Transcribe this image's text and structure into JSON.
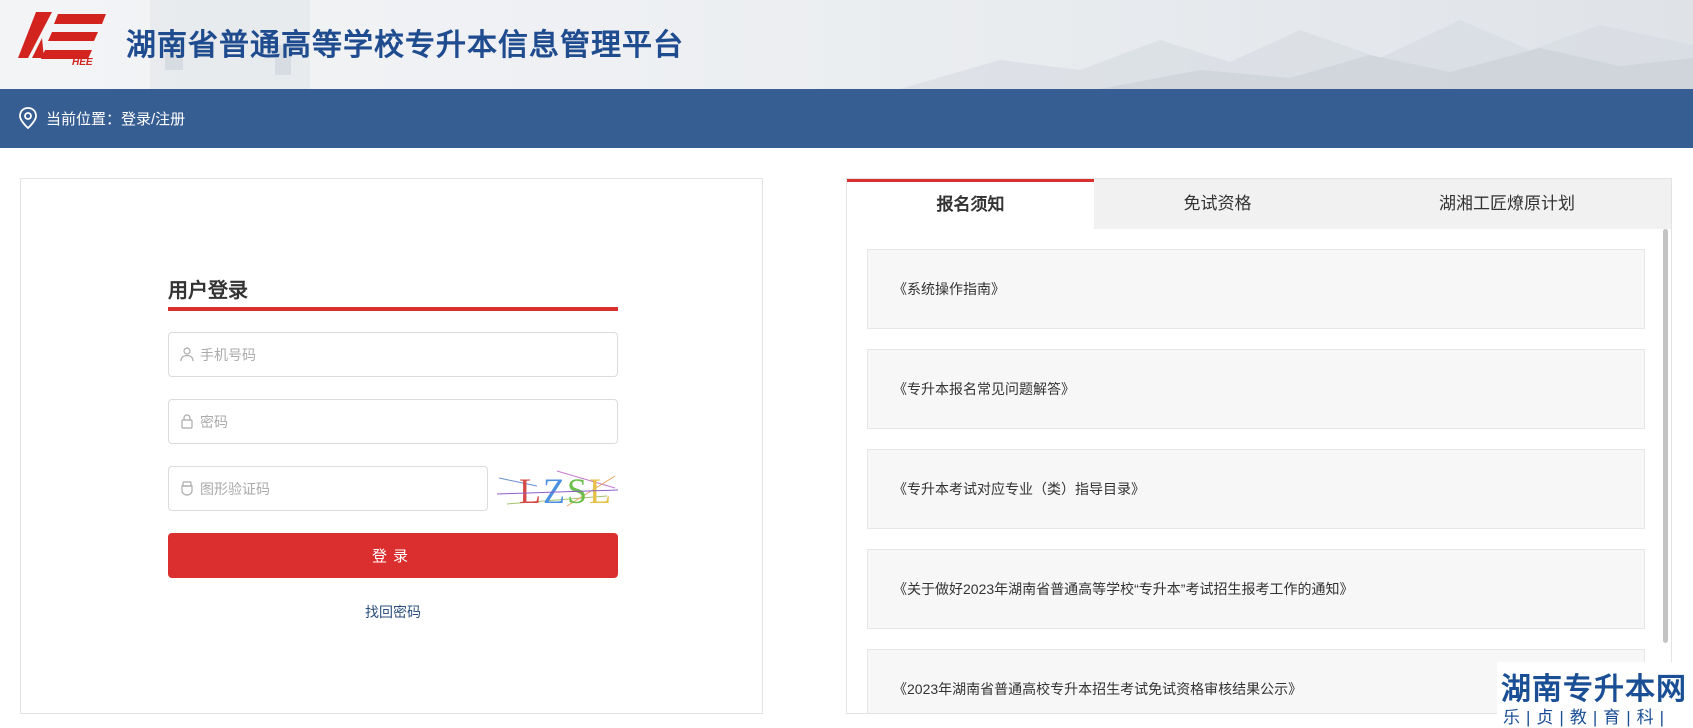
{
  "header": {
    "title": "湖南省普通高等学校专升本信息管理平台",
    "logo_text": "HEE",
    "logo_icon": "hee-logo",
    "brand_color": "#d3231f",
    "title_color": "#1f4b8f"
  },
  "breadcrumb": {
    "icon": "location-pin-icon",
    "text": "当前位置：登录/注册",
    "bar_color": "#365e92"
  },
  "login": {
    "title": "用户登录",
    "phone_placeholder": "手机号码",
    "password_placeholder": "密码",
    "captcha_placeholder": "图形验证码",
    "captcha_text": "LZSL",
    "login_label": "登录",
    "forgot_label": "找回密码",
    "accent_color": "#d8302f"
  },
  "notices": {
    "tabs": [
      {
        "label": "报名须知",
        "active": true
      },
      {
        "label": "免试资格",
        "active": false
      },
      {
        "label": "湖湘工匠燎原计划",
        "active": false
      }
    ],
    "items": [
      {
        "label": "《系统操作指南》"
      },
      {
        "label": "《专升本报名常见问题解答》"
      },
      {
        "label": "《专升本考试对应专业（类）指导目录》"
      },
      {
        "label": "《关于做好2023年湖南省普通高等学校“专升本”考试招生报考工作的通知》"
      },
      {
        "label": "《2023年湖南省普通高校专升本招生考试免试资格审核结果公示》"
      }
    ]
  },
  "watermark": {
    "title": "湖南专升本网",
    "subtitle": "乐|贞|教|育|科|技"
  }
}
